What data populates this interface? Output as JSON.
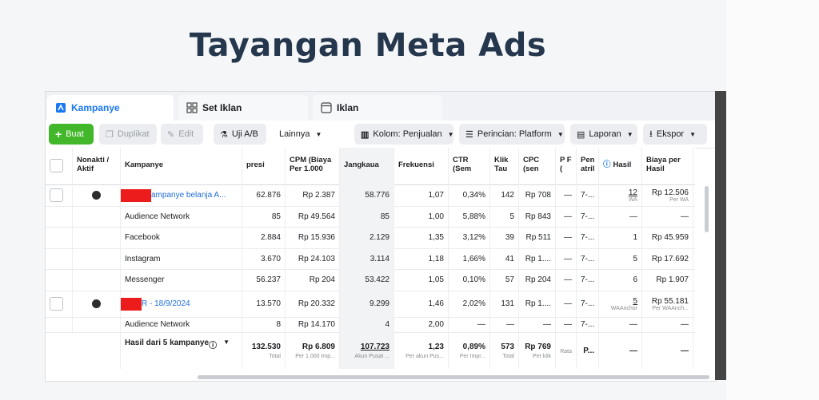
{
  "page_title": "Tayangan Meta Ads",
  "tabs": [
    {
      "label": "Kampanye",
      "icon": "flag-icon"
    },
    {
      "label": "Set Iklan",
      "icon": "grid-icon"
    },
    {
      "label": "Iklan",
      "icon": "ad-icon"
    }
  ],
  "toolbar": {
    "create": "Buat",
    "duplicate": "Duplikat",
    "edit": "Edit",
    "ab_test": "Uji A/B",
    "more": "Lainnya",
    "columns": "Kolom: Penjualan",
    "breakdown": "Perincian: Platform",
    "reports": "Laporan",
    "export": "Ekspor"
  },
  "headers": {
    "toggle": "Nonakti / Aktif",
    "campaign": "Kampanye",
    "impressions": "presi",
    "cpm": "CPM (Biaya Per 1.000",
    "reach": "Jangkaua",
    "frequency": "Frekuensi",
    "ctr": "CTR (Sem",
    "clicks": "Klik Tau",
    "cpc": "CPC (sen",
    "p": "P F (",
    "attribution": "Pen atril",
    "results": "Hasil",
    "cost_per_result": "Biaya per Hasil"
  },
  "rows": [
    {
      "name": "ampanye belanja A...",
      "impr": "62.876",
      "cpm": "Rp 2.387",
      "reach": "58.776",
      "freq": "1,07",
      "ctr": "0,34%",
      "clicks": "142",
      "cpc": "Rp 708",
      "p": "—",
      "attr": "7-...",
      "results": "12",
      "results_sub": "WA",
      "cpr": "Rp 12.506",
      "cpr_sub": "Per WA"
    },
    {
      "name": "Audience Network",
      "impr": "85",
      "cpm": "Rp 49.564",
      "reach": "85",
      "freq": "1,00",
      "ctr": "5,88%",
      "clicks": "5",
      "cpc": "Rp 843",
      "p": "—",
      "attr": "7-...",
      "results": "—",
      "results_sub": "",
      "cpr": "—",
      "cpr_sub": ""
    },
    {
      "name": "Facebook",
      "impr": "2.884",
      "cpm": "Rp 15.936",
      "reach": "2.129",
      "freq": "1,35",
      "ctr": "3,12%",
      "clicks": "39",
      "cpc": "Rp 511",
      "p": "—",
      "attr": "7-...",
      "results": "1",
      "results_sub": "",
      "cpr": "Rp 45.959",
      "cpr_sub": ""
    },
    {
      "name": "Instagram",
      "impr": "3.670",
      "cpm": "Rp 24.103",
      "reach": "3.114",
      "freq": "1,18",
      "ctr": "1,66%",
      "clicks": "41",
      "cpc": "Rp 1....",
      "p": "—",
      "attr": "7-...",
      "results": "5",
      "results_sub": "",
      "cpr": "Rp 17.692",
      "cpr_sub": ""
    },
    {
      "name": "Messenger",
      "impr": "56.237",
      "cpm": "Rp 204",
      "reach": "53.422",
      "freq": "1,05",
      "ctr": "0,10%",
      "clicks": "57",
      "cpc": "Rp 204",
      "p": "—",
      "attr": "7-...",
      "results": "6",
      "results_sub": "",
      "cpr": "Rp 1.907",
      "cpr_sub": ""
    },
    {
      "name": "R - 18/9/2024",
      "impr": "13.570",
      "cpm": "Rp 20.332",
      "reach": "9.299",
      "freq": "1,46",
      "ctr": "2,02%",
      "clicks": "131",
      "cpc": "Rp 1....",
      "p": "—",
      "attr": "7-...",
      "results": "5",
      "results_sub": "WAAnchor",
      "cpr": "Rp 55.181",
      "cpr_sub": "Per WAAnch..."
    },
    {
      "name": "Audience Network",
      "impr": "8",
      "cpm": "Rp 14.170",
      "reach": "4",
      "freq": "2,00",
      "ctr": "—",
      "clicks": "—",
      "cpc": "—",
      "p": "—",
      "attr": "7-...",
      "results": "—",
      "results_sub": "",
      "cpr": "—",
      "cpr_sub": ""
    }
  ],
  "total": {
    "label": "Hasil dari 5 kampanye",
    "impr": "132.530",
    "impr_sub": "Total",
    "cpm": "Rp 6.809",
    "cpm_sub": "Per 1.000 Imp...",
    "reach": "107.723",
    "reach_sub": "Akun Pusat ...",
    "freq": "1,23",
    "freq_sub": "Per akun Pus...",
    "ctr": "0,89%",
    "ctr_sub": "Per Impr...",
    "clicks": "573",
    "clicks_sub": "Total",
    "cpc": "Rp 769",
    "cpc_sub": "Per klik",
    "p": "",
    "p_sub": "Rata",
    "attr": "P...",
    "results": "—",
    "cpr": "—"
  },
  "colors": {
    "accent": "#1877f2",
    "create": "#42b72a",
    "redaction": "#ec1c1c",
    "title": "#25374d"
  }
}
